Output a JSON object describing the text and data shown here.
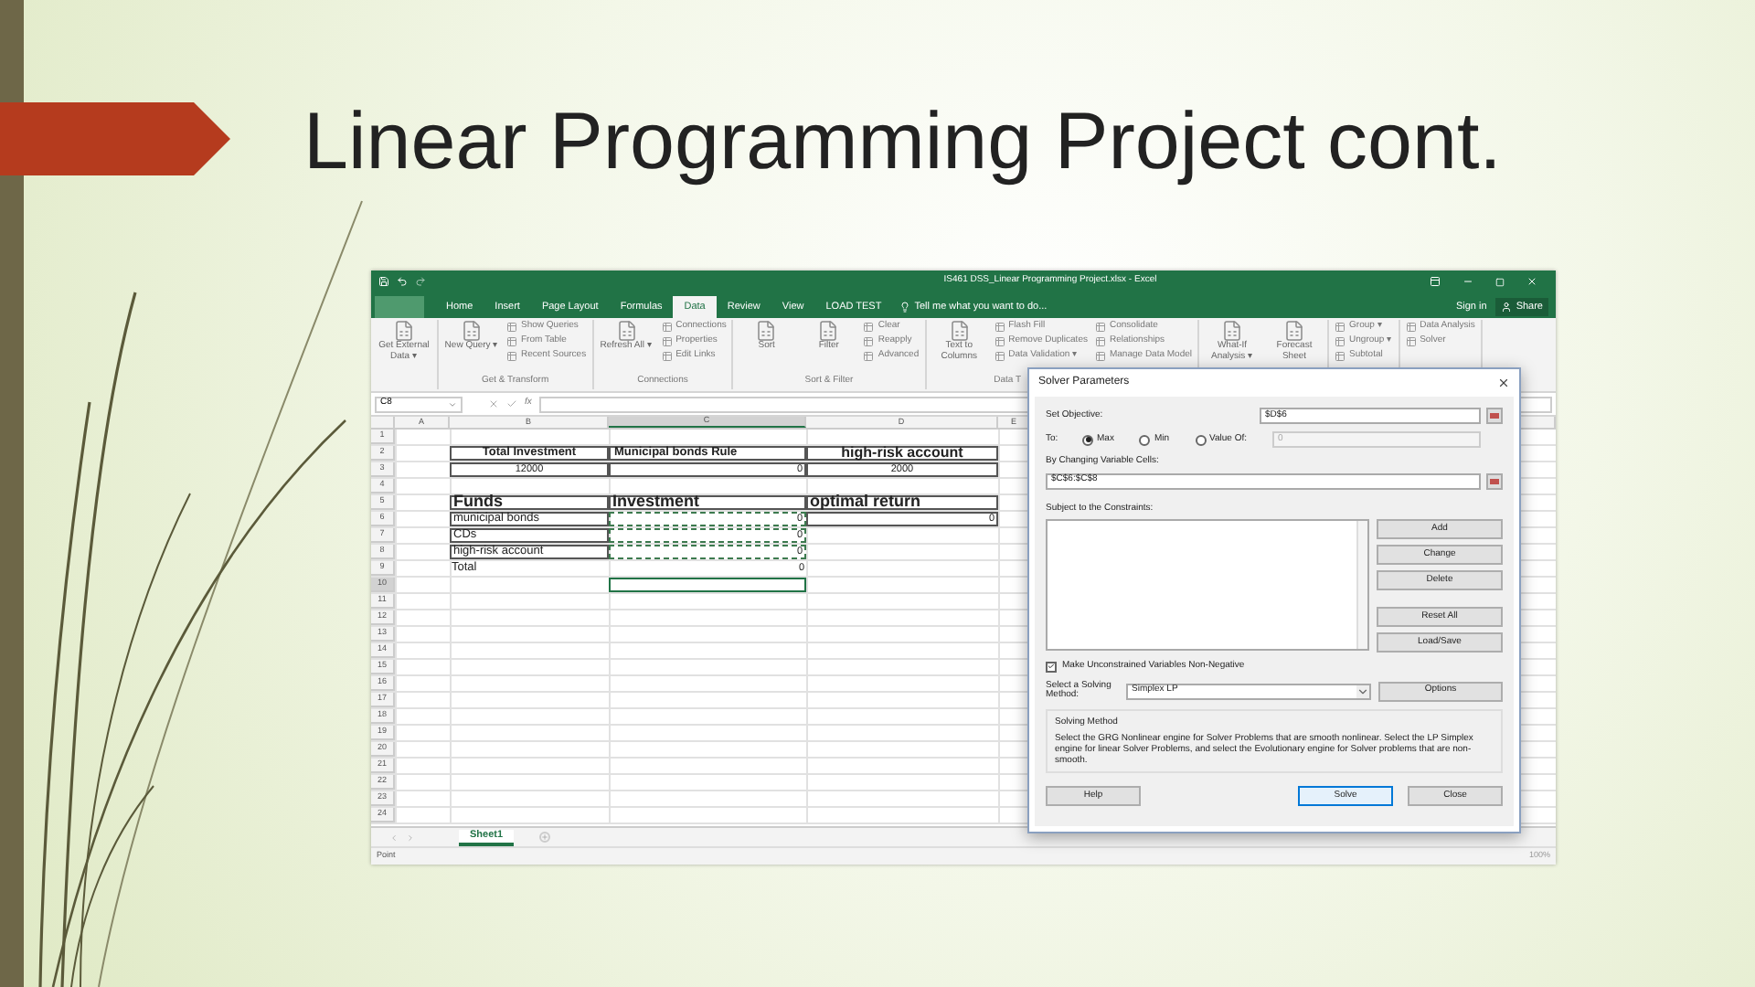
{
  "slide": {
    "title": "Linear Programming Project cont."
  },
  "excel": {
    "title_bar": {
      "filename": "IS461 DSS_Linear Programming Project.xlsx - Excel"
    },
    "tabs": [
      {
        "label": "Home",
        "selected": false
      },
      {
        "label": "Insert",
        "selected": false
      },
      {
        "label": "Page Layout",
        "selected": false
      },
      {
        "label": "Formulas",
        "selected": false
      },
      {
        "label": "Data",
        "selected": true
      },
      {
        "label": "Review",
        "selected": false
      },
      {
        "label": "View",
        "selected": false
      },
      {
        "label": "LOAD TEST",
        "selected": false
      }
    ],
    "tell_me": "Tell me what you want to do...",
    "sign_in": "Sign in",
    "share": "Share",
    "ribbon_groups": [
      {
        "items": [
          {
            "kind": "large",
            "label": "Get External Data ▾"
          }
        ]
      },
      {
        "label": "Get & Transform",
        "items": [
          {
            "kind": "large",
            "label": "New Query ▾"
          },
          {
            "kind": "small",
            "label": "Show Queries"
          },
          {
            "kind": "small",
            "label": "From Table"
          },
          {
            "kind": "small",
            "label": "Recent Sources"
          }
        ]
      },
      {
        "label": "Connections",
        "items": [
          {
            "kind": "large",
            "label": "Refresh All ▾"
          },
          {
            "kind": "small",
            "label": "Connections"
          },
          {
            "kind": "small",
            "label": "Properties"
          },
          {
            "kind": "small",
            "label": "Edit Links"
          }
        ]
      },
      {
        "label": "Sort & Filter",
        "items": [
          {
            "kind": "large",
            "label": "Sort"
          },
          {
            "kind": "large",
            "label": "Filter"
          },
          {
            "kind": "small",
            "label": "Clear"
          },
          {
            "kind": "small",
            "label": "Reapply"
          },
          {
            "kind": "small",
            "label": "Advanced"
          }
        ]
      },
      {
        "label": "Data T",
        "items": [
          {
            "kind": "large",
            "label": "Text to Columns"
          },
          {
            "kind": "small",
            "label": "Flash Fill"
          },
          {
            "kind": "small",
            "label": "Remove Duplicates"
          },
          {
            "kind": "small",
            "label": "Data Validation ▾"
          },
          {
            "kind": "small",
            "label": "Consolidate"
          },
          {
            "kind": "small",
            "label": "Relationships"
          },
          {
            "kind": "small",
            "label": "Manage Data Model"
          }
        ]
      },
      {
        "items": [
          {
            "kind": "large",
            "label": "What-If Analysis ▾"
          },
          {
            "kind": "large",
            "label": "Forecast Sheet"
          }
        ]
      },
      {
        "items": [
          {
            "kind": "small",
            "label": "Group ▾"
          },
          {
            "kind": "small",
            "label": "Ungroup ▾"
          },
          {
            "kind": "small",
            "label": "Subtotal"
          }
        ]
      },
      {
        "items": [
          {
            "kind": "small",
            "label": "Data Analysis"
          },
          {
            "kind": "small",
            "label": "Solver"
          }
        ]
      }
    ],
    "name_box": "C8",
    "fx": "fx",
    "columns": [
      "A",
      "B",
      "C",
      "D",
      "E"
    ],
    "rows": [
      {
        "label": "1"
      },
      {
        "label": "2",
        "cells": [
          null,
          {
            "text": "Total Investment",
            "kind": "header",
            "selected": false
          },
          {
            "text": "Municipal bonds Rule",
            "kind": "header-left",
            "selected": false
          },
          {
            "text": "high-risk account",
            "kind": "header-big",
            "selected": false
          },
          null
        ]
      },
      {
        "label": "3",
        "cells": [
          null,
          {
            "text": "12000",
            "kind": "center",
            "selected": false
          },
          {
            "text": "0",
            "kind": "right",
            "selected": false
          },
          {
            "text": "2000",
            "kind": "center",
            "selected": false
          },
          null
        ]
      },
      {
        "label": "4"
      },
      {
        "label": "5",
        "cells": [
          null,
          {
            "text": "Funds",
            "kind": "title",
            "selected": false
          },
          {
            "text": "Investment",
            "kind": "title",
            "selected": false
          },
          {
            "text": "optimal return",
            "kind": "title",
            "selected": false
          },
          null
        ]
      },
      {
        "label": "6",
        "cells": [
          null,
          {
            "text": "municipal bonds",
            "kind": "label",
            "selected": false
          },
          {
            "text": "0",
            "kind": "copy",
            "selected": false
          },
          {
            "text": "0",
            "kind": "right",
            "selected": false
          },
          null
        ]
      },
      {
        "label": "7",
        "cells": [
          null,
          {
            "text": "CDs",
            "kind": "label",
            "selected": false
          },
          {
            "text": "0",
            "kind": "copy",
            "selected": false
          },
          null,
          null
        ]
      },
      {
        "label": "8",
        "cells": [
          null,
          {
            "text": "high-risk account",
            "kind": "label",
            "selected": false
          },
          {
            "text": "0",
            "kind": "copy",
            "selected": false
          },
          null,
          null
        ]
      },
      {
        "label": "9",
        "cells": [
          null,
          {
            "text": "Total",
            "kind": "plain",
            "selected": false
          },
          {
            "text": "0",
            "kind": "plain-right",
            "selected": false
          },
          null,
          null
        ]
      },
      {
        "label": "10",
        "cells": [
          null,
          null,
          {
            "kind": "plain",
            "selected": true
          },
          null,
          null
        ]
      },
      {
        "label": "11"
      },
      {
        "label": "12"
      },
      {
        "label": "13"
      },
      {
        "label": "14"
      },
      {
        "label": "15"
      },
      {
        "label": "16"
      },
      {
        "label": "17"
      },
      {
        "label": "18"
      },
      {
        "label": "19"
      },
      {
        "label": "20"
      },
      {
        "label": "21"
      },
      {
        "label": "22"
      },
      {
        "label": "23"
      },
      {
        "label": "24"
      }
    ],
    "sheets": [
      {
        "label": "Sheet1",
        "selected": true
      }
    ],
    "status": "Point",
    "zoom": "100%"
  },
  "solver": {
    "title": "Solver Parameters",
    "objective_label": "Set Objective:",
    "objective": "$D$6",
    "to_label": "To:",
    "targets": [
      {
        "label": "Max",
        "selected": true
      },
      {
        "label": "Min",
        "selected": false
      },
      {
        "label": "Value Of:",
        "selected": false
      }
    ],
    "value_of": "0",
    "changing_label": "By Changing Variable Cells:",
    "changing": "$C$6:$C$8",
    "constraints_label": "Subject to the Constraints:",
    "side_buttons": [
      "Add",
      "Change",
      "Delete",
      "Reset All",
      "Load/Save"
    ],
    "nonneg": {
      "label": "Make Unconstrained Variables Non-Negative",
      "checked": true
    },
    "method_label": "Select a Solving Method:",
    "method": "Simplex LP",
    "options": "Options",
    "method_group": "Solving Method",
    "method_text": "Select the GRG Nonlinear engine for Solver Problems that are smooth nonlinear. Select the LP Simplex engine for linear Solver Problems, and select the Evolutionary engine for Solver problems that are non-smooth.",
    "footer": [
      {
        "label": "Help",
        "default": false
      },
      {
        "label": "Solve",
        "default": true
      },
      {
        "label": "Close",
        "default": false
      }
    ]
  }
}
